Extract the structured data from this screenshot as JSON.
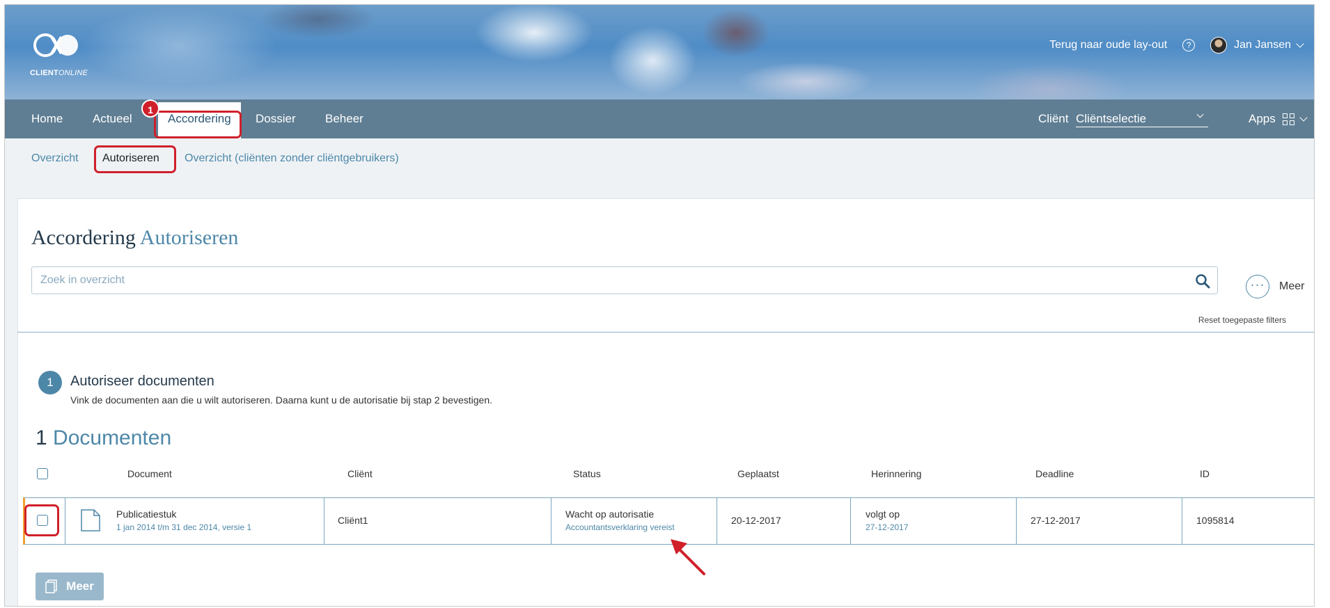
{
  "header": {
    "logo_text_bold": "CLIENT",
    "logo_text_italic": "ONLINE",
    "back_link": "Terug naar oude lay-out",
    "help_icon": "?",
    "user_name": "Jan Jansen"
  },
  "nav": {
    "items": [
      {
        "label": "Home"
      },
      {
        "label": "Actueel"
      },
      {
        "label": "Accordering"
      },
      {
        "label": "Dossier"
      },
      {
        "label": "Beheer"
      }
    ],
    "active_badge": "1",
    "client_label": "Cliënt",
    "client_select_value": "Cliëntselectie",
    "apps_label": "Apps"
  },
  "subnav": {
    "items": [
      {
        "label": "Overzicht"
      },
      {
        "label": "Autoriseren"
      },
      {
        "label": "Overzicht (cliënten zonder cliëntgebruikers)"
      }
    ]
  },
  "page": {
    "title_main": "Accordering",
    "title_accent": "Autoriseren",
    "search_placeholder": "Zoek in overzicht",
    "more_label": "Meer",
    "more_glyph": "···",
    "reset_filters": "Reset toegepaste filters"
  },
  "step": {
    "number": "1",
    "title": "Autoriseer documenten",
    "description": "Vink de documenten aan die u wilt autoriseren. Daarna kunt u de autorisatie bij stap 2 bevestigen."
  },
  "documents": {
    "count": "1",
    "label": "Documenten",
    "columns": [
      "Document",
      "Cliënt",
      "Status",
      "Geplaatst",
      "Herinnering",
      "Deadline",
      "ID"
    ],
    "rows": [
      {
        "document_name": "Publicatiestuk",
        "document_sub": "1 jan 2014 t/m 31 dec 2014, versie 1",
        "client": "Cliënt1",
        "status": "Wacht op autorisatie",
        "status_sub": "Accountantsverklaring vereist",
        "placed": "20-12-2017",
        "reminder": "volgt op",
        "reminder_sub": "27-12-2017",
        "deadline": "27-12-2017",
        "id": "1095814"
      }
    ]
  },
  "footer_actions": {
    "more_button": "Meer"
  },
  "colors": {
    "accent": "#4d87a8",
    "highlight": "#d0202a",
    "row_edge": "#f0a030"
  }
}
